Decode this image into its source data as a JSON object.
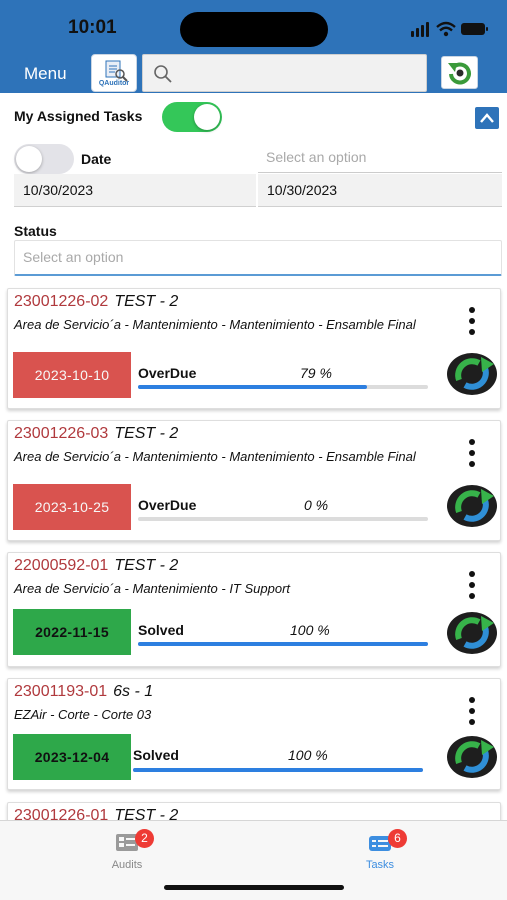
{
  "status_bar": {
    "time": "10:01"
  },
  "header": {
    "menu_label": "Menu",
    "logo_text": "QAuditor",
    "search_placeholder": "",
    "icons": {
      "search": "search-icon",
      "refresh": "refresh-icon"
    },
    "colors": {
      "bar": "#2e73b9"
    }
  },
  "filters": {
    "assigned_label": "My Assigned Tasks",
    "assigned_on": true,
    "date_label": "Date",
    "date_on": false,
    "date_option_placeholder": "Select an option",
    "date_from": "10/30/2023",
    "date_to": "10/30/2023",
    "status_label": "Status",
    "status_placeholder": "Select an option"
  },
  "tasks": [
    {
      "code": "23001226-02",
      "title": "TEST - 2",
      "location": "Area de Servicio´a - Mantenimiento - Mantenimiento - Ensamble Final",
      "date": "2023-10-10",
      "state": "OverDue",
      "progress_label": "79 %",
      "progress": 0.79,
      "badge_color": "#d9534f"
    },
    {
      "code": "23001226-03",
      "title": "TEST - 2",
      "location": "Area de Servicio´a - Mantenimiento - Mantenimiento - Ensamble Final",
      "date": "2023-10-25",
      "state": "OverDue",
      "progress_label": "0 %",
      "progress": 0.0,
      "badge_color": "#d9534f"
    },
    {
      "code": "22000592-01",
      "title": "TEST - 2",
      "location": "Area de Servicio´a - Mantenimiento - IT Support",
      "date": "2022-11-15",
      "state": "Solved",
      "progress_label": "100 %",
      "progress": 1.0,
      "badge_color": "#2ea84a"
    },
    {
      "code": "23001193-01",
      "title": "6s - 1",
      "location": "EZAir - Corte - Corte 03",
      "date": "2023-12-04",
      "state": "Solved",
      "progress_label": "100 %",
      "progress": 1.0,
      "badge_color": "#2ea84a"
    },
    {
      "code": "23001226-01",
      "title": "TEST - 2"
    }
  ],
  "tab_bar": {
    "audits_label": "Audits",
    "audits_count": "2",
    "tasks_label": "Tasks",
    "tasks_count": "6",
    "active": "tasks"
  }
}
